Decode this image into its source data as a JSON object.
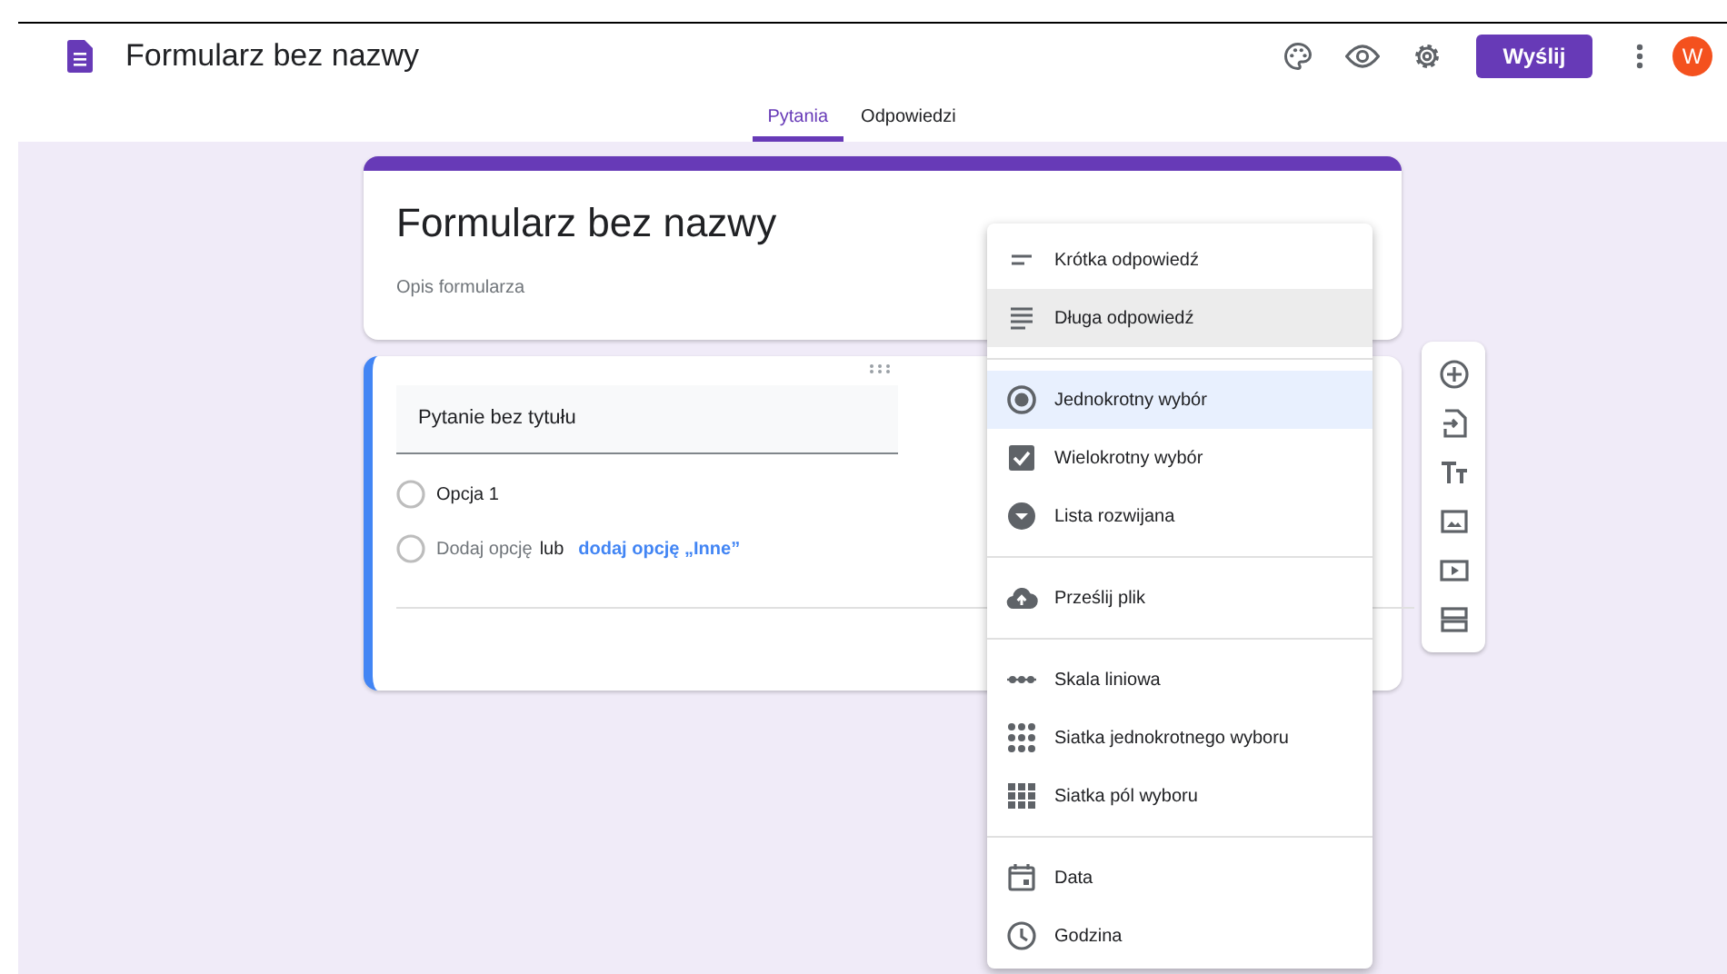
{
  "header": {
    "title": "Formularz bez nazwy",
    "send_button": "Wyślij",
    "avatar": "W"
  },
  "tabs": [
    {
      "label": "Pytania",
      "selected": true
    },
    {
      "label": "Odpowiedzi",
      "selected": false
    }
  ],
  "form_header": {
    "title": "Formularz bez nazwy",
    "description_placeholder": "Opis formularza"
  },
  "question": {
    "title_placeholder": "Pytanie bez tytułu",
    "options": [
      "Opcja 1"
    ],
    "add_option": "Dodaj opcję",
    "or": "lub",
    "add_other": "dodaj opcję „Inne”"
  },
  "toolbar": [
    {
      "kind": "add"
    },
    {
      "kind": "import"
    },
    {
      "kind": "text"
    },
    {
      "kind": "image"
    },
    {
      "kind": "video"
    },
    {
      "kind": "section"
    }
  ],
  "type_menu": {
    "groups": [
      [
        {
          "kind": "short",
          "label": "Krótka odpowiedź",
          "selected": false,
          "hovered": false
        },
        {
          "kind": "long",
          "label": "Długa odpowiedź",
          "selected": false,
          "hovered": true
        }
      ],
      [
        {
          "kind": "radio",
          "label": "Jednokrotny wybór",
          "selected": true,
          "hovered": false
        },
        {
          "kind": "checkbox",
          "label": "Wielokrotny wybór",
          "selected": false,
          "hovered": false
        },
        {
          "kind": "dropdown",
          "label": "Lista rozwijana",
          "selected": false,
          "hovered": false
        }
      ],
      [
        {
          "kind": "upload",
          "label": "Prześlij plik",
          "selected": false,
          "hovered": false
        }
      ],
      [
        {
          "kind": "scale",
          "label": "Skala liniowa",
          "selected": false,
          "hovered": false
        },
        {
          "kind": "grid",
          "label": "Siatka jednokrotnego wyboru",
          "selected": false,
          "hovered": false
        },
        {
          "kind": "checkgrid",
          "label": "Siatka pól wyboru",
          "selected": false,
          "hovered": false
        }
      ],
      [
        {
          "kind": "date",
          "label": "Data",
          "selected": false,
          "hovered": false
        },
        {
          "kind": "time",
          "label": "Godzina",
          "selected": false,
          "hovered": false
        }
      ]
    ]
  }
}
